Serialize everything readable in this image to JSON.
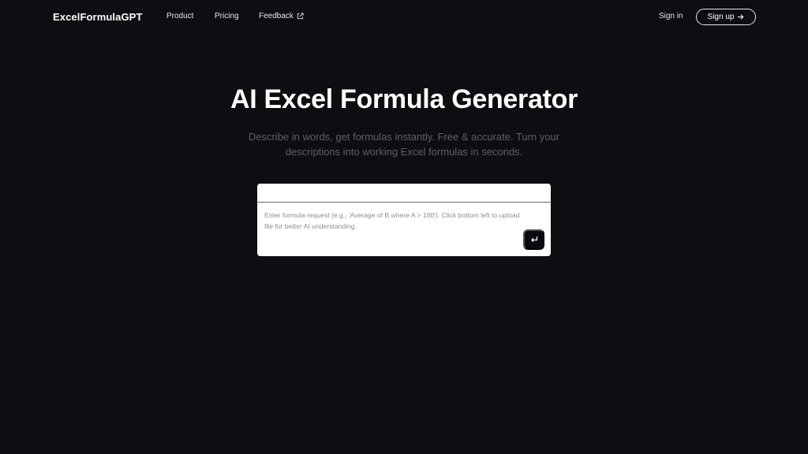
{
  "header": {
    "logo": "ExcelFormulaGPT",
    "nav": {
      "product": "Product",
      "pricing": "Pricing",
      "feedback": "Feedback"
    },
    "signin": "Sign in",
    "signup": "Sign up"
  },
  "hero": {
    "title": "AI Excel Formula Generator",
    "subtitle": "Describe in words, get formulas instantly. Free & accurate. Turn your descriptions into working Excel formulas in seconds."
  },
  "input": {
    "placeholder": "Enter formula request (e.g., 'Average of B where A > 100'). Click bottom left to upload file for better AI understanding."
  },
  "icons": {
    "feedback": "external-link-icon",
    "signup": "arrow-right-icon",
    "send": "enter-return-icon"
  },
  "colors": {
    "background": "#0e0d11",
    "subtitle": "#5f5f68",
    "card": "#ffffff",
    "send_button": "#0b0b0d"
  }
}
